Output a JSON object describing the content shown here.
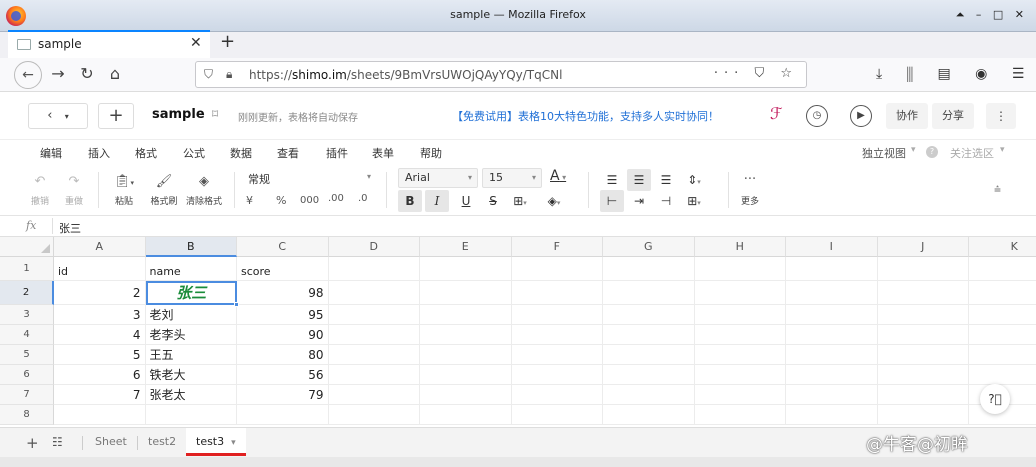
{
  "window": {
    "title": "sample — Mozilla Firefox",
    "controls": [
      "⏶",
      "–",
      "□",
      "✕"
    ]
  },
  "browser": {
    "tab_label": "sample",
    "url_prefix": "https://",
    "url_host": "shimo.im",
    "url_path": "/sheets/9BmVrsUWOjQAyYQy/TqCNl",
    "url_right_icons": "··· ⛉ ☆",
    "right_icons": "⤓ ⫼ ▤ ◉ ☰"
  },
  "app": {
    "doc_title": "sample",
    "save_status": "刚刚更新，表格将自动保存",
    "promo": "【免费试用】表格10大特色功能，支持多人实时协同！",
    "collaborate": "协作",
    "share": "分享"
  },
  "menu": {
    "items": [
      "编辑",
      "插入",
      "格式",
      "公式",
      "数据",
      "查看",
      "插件",
      "表单",
      "帮助"
    ],
    "view_mode": "独立视图",
    "follow": "关注选区"
  },
  "toolbar": {
    "undo": "撤销",
    "redo": "重做",
    "paste": "粘贴",
    "format_painter": "格式刷",
    "clear_format": "清除格式",
    "number_format": "常规",
    "currency": "¥",
    "percent": "%",
    "thousands": "000",
    "inc_decimal": ".00",
    "dec_decimal": ".0",
    "font": "Arial",
    "font_size": "15",
    "more": "更多"
  },
  "formula_bar": {
    "fx": "fx",
    "value": "张三"
  },
  "grid": {
    "columns": [
      "A",
      "B",
      "C",
      "D",
      "E",
      "F",
      "G",
      "H",
      "I",
      "J",
      "K"
    ],
    "rows": [
      "1",
      "2",
      "3",
      "4",
      "5",
      "6",
      "7",
      "8"
    ],
    "cells": [
      [
        "id",
        "name",
        "score"
      ],
      [
        "2",
        "张三",
        "98"
      ],
      [
        "3",
        "老刘",
        "95"
      ],
      [
        "4",
        "老李头",
        "90"
      ],
      [
        "5",
        "王五",
        "80"
      ],
      [
        "6",
        "铁老大",
        "56"
      ],
      [
        "7",
        "张老太",
        "79"
      ],
      [
        "",
        "",
        ""
      ]
    ],
    "selected_color": "#1a8c3a"
  },
  "sheets": {
    "tabs": [
      "Sheet",
      "test2",
      "test3"
    ],
    "active": "test3"
  },
  "watermark": "@牛客@初眸"
}
